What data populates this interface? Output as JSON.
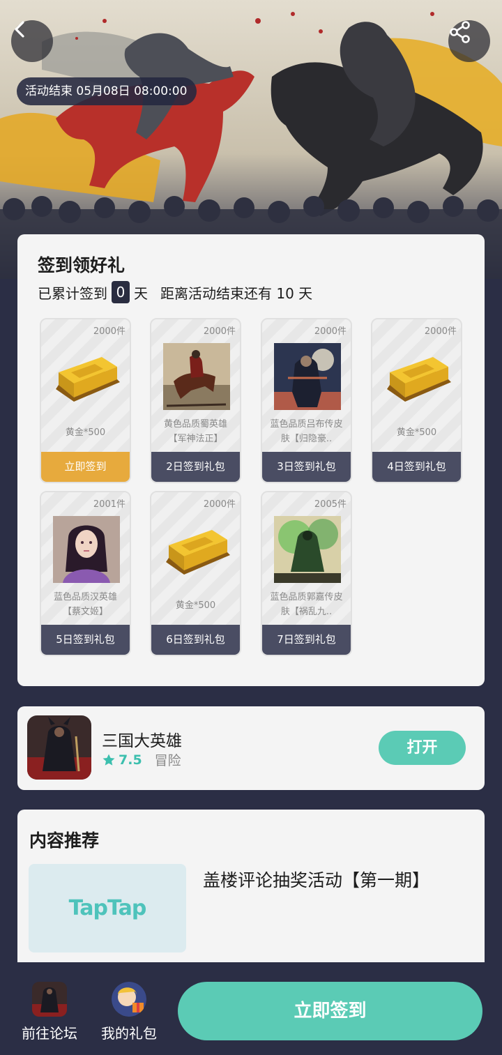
{
  "hero": {
    "end_label": "活动结束 05月08日 08:00:00",
    "back_icon": "chevron-left-icon",
    "share_icon": "share-icon"
  },
  "signin": {
    "title": "签到领好礼",
    "accum_prefix": "已累计签到",
    "days_signed": "0",
    "day_unit": "天",
    "remaining_text": "距离活动结束还有 10 天",
    "gifts": [
      {
        "count": "2000件",
        "name": "黄金*500",
        "button": "立即签到",
        "art": "gold-bar",
        "active": true
      },
      {
        "count": "2000件",
        "name": "黄色品质蜀英雄【军神法正】",
        "button": "2日签到礼包",
        "art": "rider-portrait",
        "active": false
      },
      {
        "count": "2000件",
        "name": "蓝色品质吕布传皮肤【归隐豪..",
        "button": "3日签到礼包",
        "art": "warrior-portrait",
        "active": false
      },
      {
        "count": "2000件",
        "name": "黄金*500",
        "button": "4日签到礼包",
        "art": "gold-bar",
        "active": false
      },
      {
        "count": "2001件",
        "name": "蓝色品质汉英雄【蔡文姬】",
        "button": "5日签到礼包",
        "art": "lady-portrait",
        "active": false
      },
      {
        "count": "2000件",
        "name": "黄金*500",
        "button": "6日签到礼包",
        "art": "gold-bar",
        "active": false
      },
      {
        "count": "2005件",
        "name": "蓝色品质郭嘉传皮肤【祸乱九..",
        "button": "7日签到礼包",
        "art": "green-warrior-portrait",
        "active": false
      }
    ]
  },
  "game": {
    "name": "三国大英雄",
    "score": "7.5",
    "genre": "冒险",
    "open_label": "打开",
    "star_icon": "star-icon"
  },
  "recommend": {
    "title": "内容推荐",
    "banner_brand": "TapTap",
    "post_title": "盖楼评论抽奖活动【第一期】"
  },
  "bottom": {
    "forum_label": "前往论坛",
    "gifts_label": "我的礼包",
    "cta_label": "立即签到"
  },
  "colors": {
    "accent": "#5bcbb5",
    "active_gift": "#e7aa3d",
    "dark": "#2b2e45"
  }
}
